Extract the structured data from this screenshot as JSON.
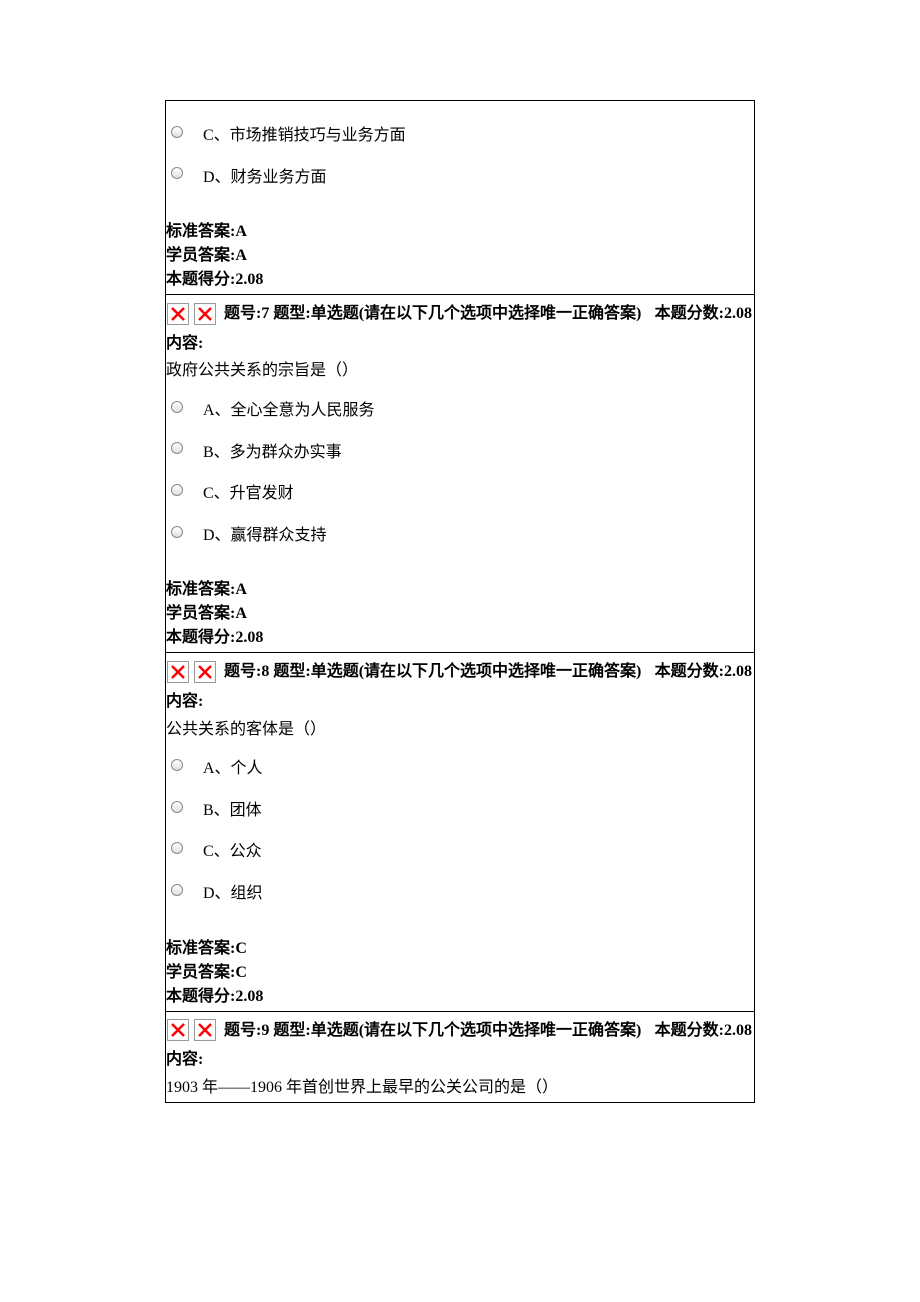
{
  "labels": {
    "content": "内容:",
    "standardAnswer": "标准答案:",
    "studentAnswer": "学员答案:",
    "scoreEarned": "本题得分:",
    "questionNum": "题号:",
    "questionType": "题型:",
    "typeDesc": "单选题(请在以下几个选项中选择唯一正确答案)",
    "questionScore": "本题分数:"
  },
  "q6": {
    "optionC": "C、市场推销技巧与业务方面",
    "optionD": "D、财务业务方面",
    "standardAnswer": "A",
    "studentAnswer": "A",
    "scoreEarned": "2.08"
  },
  "q7": {
    "num": "7",
    "score": "2.08",
    "content": "政府公共关系的宗旨是（）",
    "optionA": "A、全心全意为人民服务",
    "optionB": "B、多为群众办实事",
    "optionC": "C、升官发财",
    "optionD": "D、赢得群众支持",
    "standardAnswer": "A",
    "studentAnswer": "A",
    "scoreEarned": "2.08"
  },
  "q8": {
    "num": "8",
    "score": "2.08",
    "content": "公共关系的客体是（）",
    "optionA": "A、个人",
    "optionB": "B、团体",
    "optionC": "C、公众",
    "optionD": "D、组织",
    "standardAnswer": "C",
    "studentAnswer": "C",
    "scoreEarned": "2.08"
  },
  "q9": {
    "num": "9",
    "score": "2.08",
    "content": "1903 年——1906 年首创世界上最早的公关公司的是（）"
  }
}
